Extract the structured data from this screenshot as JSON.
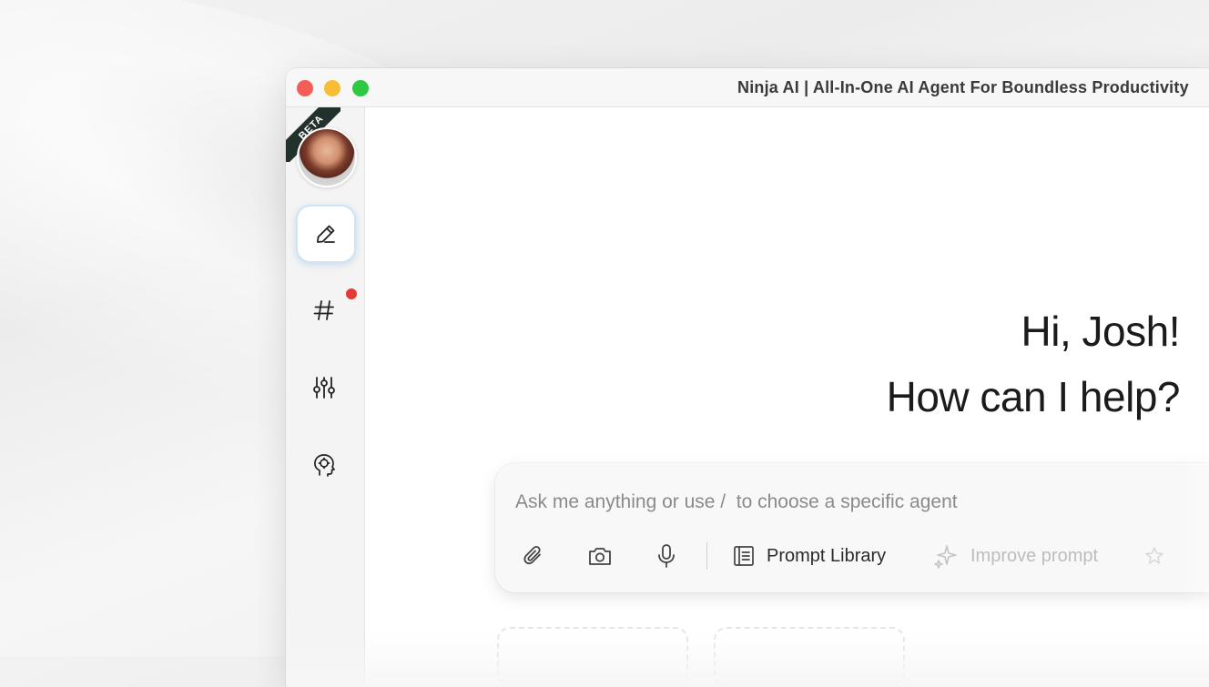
{
  "window": {
    "title": "Ninja AI | All-In-One AI Agent For Boundless Productivity"
  },
  "sidebar": {
    "beta_label": "BETA",
    "items": [
      {
        "name": "new-chat",
        "icon": "pencil-icon",
        "active": true
      },
      {
        "name": "channels",
        "icon": "hash-icon",
        "notification": true
      },
      {
        "name": "settings",
        "icon": "sliders-icon"
      },
      {
        "name": "agents",
        "icon": "brain-head-icon"
      }
    ]
  },
  "greeting": {
    "line1": "Hi, Josh!",
    "line2": "How can I help?"
  },
  "composer": {
    "placeholder": "Ask me anything or use /  to choose a specific agent",
    "prompt_library_label": "Prompt Library",
    "improve_prompt_label": "Improve prompt"
  },
  "colors": {
    "accent_border": "#cfe4f7",
    "notification": "#e53935",
    "beta_ribbon": "#23312c"
  }
}
